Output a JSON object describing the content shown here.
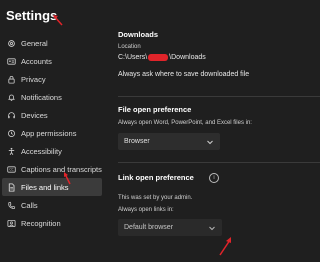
{
  "window": {
    "title": "Settings"
  },
  "sidebar": {
    "items": [
      {
        "label": "General",
        "icon": "gear-icon",
        "selected": false
      },
      {
        "label": "Accounts",
        "icon": "id-card-icon",
        "selected": false
      },
      {
        "label": "Privacy",
        "icon": "lock-icon",
        "selected": false
      },
      {
        "label": "Notifications",
        "icon": "bell-icon",
        "selected": false
      },
      {
        "label": "Devices",
        "icon": "headset-icon",
        "selected": false
      },
      {
        "label": "App permissions",
        "icon": "shield-icon",
        "selected": false
      },
      {
        "label": "Accessibility",
        "icon": "accessibility-icon",
        "selected": false
      },
      {
        "label": "Captions and transcripts",
        "icon": "captions-icon",
        "selected": false
      },
      {
        "label": "Files and links",
        "icon": "document-icon",
        "selected": true
      },
      {
        "label": "Calls",
        "icon": "phone-icon",
        "selected": false
      },
      {
        "label": "Recognition",
        "icon": "recognition-icon",
        "selected": false
      }
    ]
  },
  "downloads": {
    "title": "Downloads",
    "location_label": "Location",
    "path_prefix": "C:\\Users\\",
    "path_suffix": "\\Downloads",
    "always_ask": "Always ask where to save downloaded file"
  },
  "file_open": {
    "title": "File open preference",
    "description": "Always open Word, PowerPoint, and Excel files in:",
    "selected": "Browser"
  },
  "link_open": {
    "title": "Link open preference",
    "note": "This was set by your admin.",
    "description": "Always open links in:",
    "selected": "Default browser"
  },
  "colors": {
    "background": "#1f1f1f",
    "selected_item": "#3b3b3b",
    "annotation_arrow": "#e0242a",
    "redaction": "#e0242a"
  }
}
